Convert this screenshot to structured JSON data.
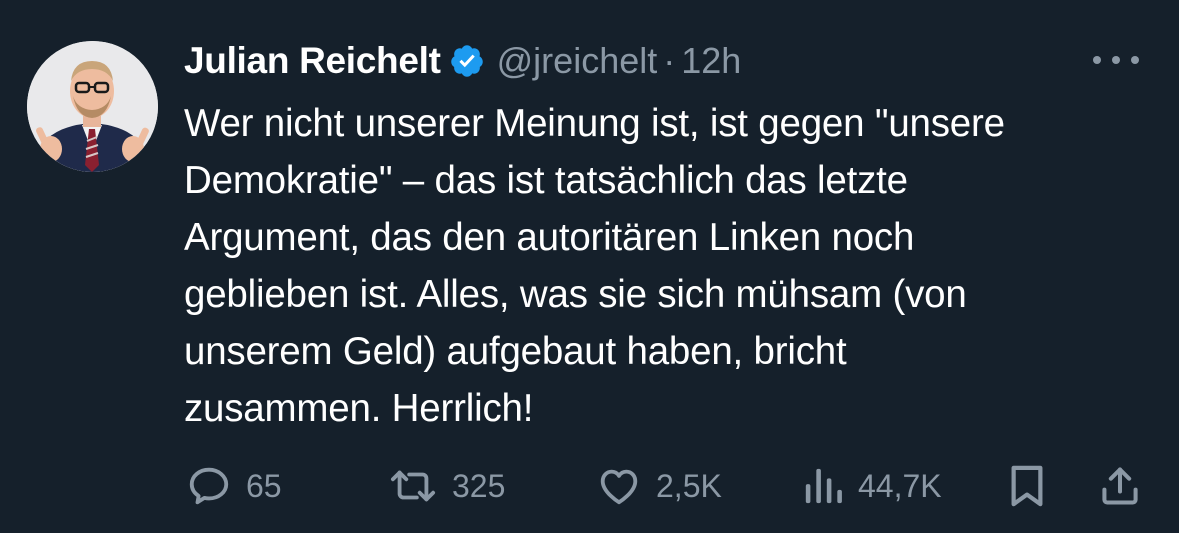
{
  "author": {
    "name": "Julian Reichelt",
    "handle": "@jreichelt",
    "separator": "·",
    "time": "12h",
    "verified": true
  },
  "tweet": {
    "text": "Wer nicht unserer Meinung ist, ist gegen \"unsere\nDemokratie\" – das ist tatsächlich das letzte\nArgument, das den autoritären Linken noch\ngeblieben ist. Alles, was sie sich mühsam (von\nunserem Geld) aufgebaut haben, bricht\nzusammen. Herrlich!"
  },
  "actions": {
    "replies": "65",
    "reposts": "325",
    "likes": "2,5K",
    "views": "44,7K"
  },
  "icons": {
    "more": "more-dots-icon",
    "reply": "reply-bubble-icon",
    "repost": "repost-arrows-icon",
    "like": "heart-icon",
    "views": "views-bar-chart-icon",
    "bookmark": "bookmark-icon",
    "share": "share-upload-icon",
    "verified": "verified-badge-icon"
  },
  "colors": {
    "background": "#15202b",
    "text_primary": "#ffffff",
    "text_secondary": "#8b98a5",
    "verified_blue": "#1d9bf0"
  }
}
